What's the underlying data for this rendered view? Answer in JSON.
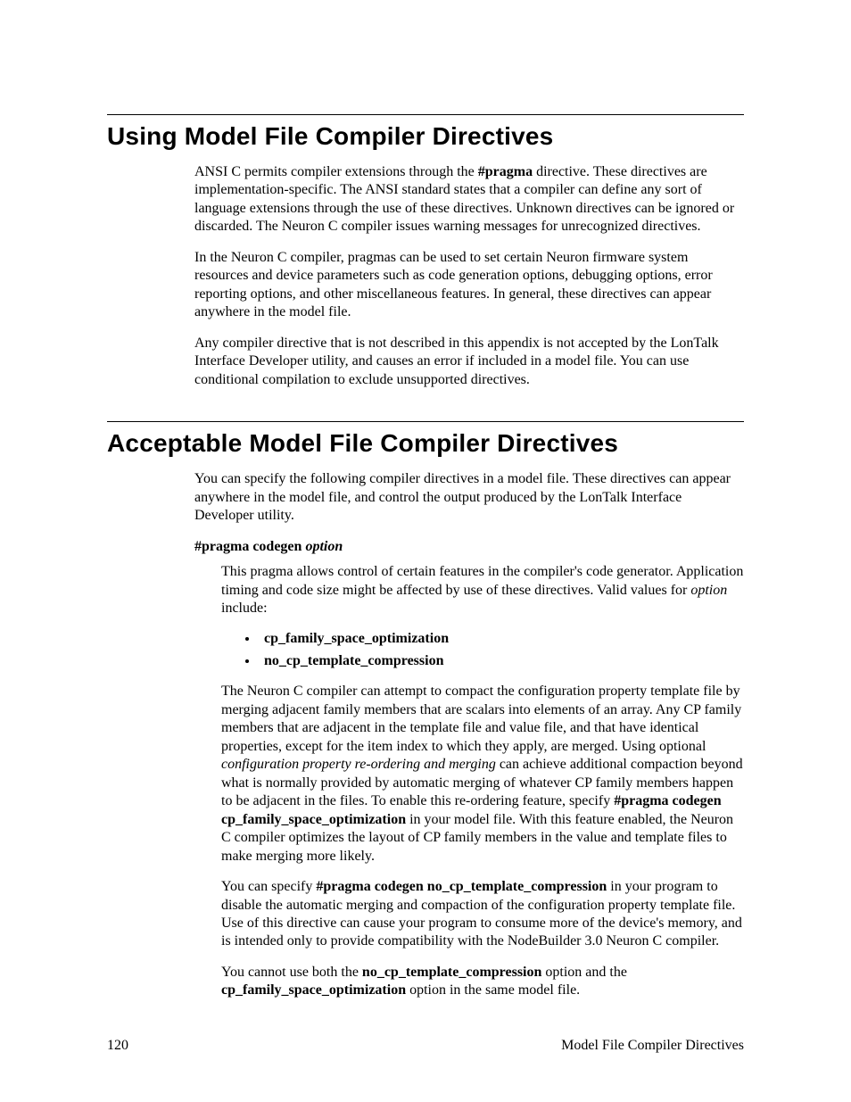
{
  "section1": {
    "heading": "Using Model File Compiler Directives",
    "p1_a": "ANSI C permits compiler extensions through the ",
    "p1_b": "#pragma",
    "p1_c": " directive.  These directives are implementation-specific.  The ANSI standard states that a compiler can define any sort of language extensions through the use of these directives.  Unknown directives can be ignored or discarded.  The Neuron C compiler issues warning messages for unrecognized directives.",
    "p2": "In the Neuron C compiler, pragmas can be used to set certain Neuron firmware system resources and device parameters such as code generation options, debugging options, error reporting options, and other miscellaneous features. In general, these directives can appear anywhere in the model file.",
    "p3": "Any compiler directive that is not described in this appendix is not accepted by the LonTalk Interface Developer utility, and causes an error if included in a model file.  You can use conditional compilation to exclude unsupported directives."
  },
  "section2": {
    "heading": "Acceptable Model File Compiler Directives",
    "p1": "You can specify the following compiler directives in a model file.  These directives can appear anywhere in the model file, and control the output produced by the LonTalk Interface Developer utility.",
    "dir_a": "#pragma codegen",
    "dir_b": " option",
    "p2_a": "This pragma allows control of certain features in the compiler's code generator.  Application timing and code size might be affected by use of these directives.  Valid values for ",
    "p2_b": "option",
    "p2_c": " include:",
    "opt1": "cp_family_space_optimization",
    "opt2": "no_cp_template_compression",
    "p3_a": "The Neuron C compiler can attempt to compact the configuration property template file by merging adjacent family members that are scalars into elements of an array.  Any CP family members that are adjacent in the template file and value file, and that have identical properties, except for the item index to which they apply, are merged.  Using optional ",
    "p3_b": "configuration property re-ordering and merging",
    "p3_c": " can achieve additional compaction beyond what is normally provided by automatic merging of whatever CP family members happen to be adjacent in the files.  To enable this re-ordering feature, specify ",
    "p3_d": "#pragma codegen cp_family_space_optimization",
    "p3_e": " in your model file.  With this feature enabled, the Neuron C compiler optimizes the layout of CP family members in the value and template files to make merging more likely.",
    "p4_a": "You can specify ",
    "p4_b": "#pragma codegen no_cp_template_compression",
    "p4_c": " in your program to disable the automatic merging and compaction of the configuration property template file.  Use of this directive can cause your program to consume more of the device's memory, and is intended only to provide compatibility with the NodeBuilder 3.0 Neuron C compiler.",
    "p5_a": "You cannot use both the ",
    "p5_b": "no_cp_template_compression",
    "p5_c": " option and the ",
    "p5_d": "cp_family_space_optimization",
    "p5_e": " option in the same model file."
  },
  "footer": {
    "page": "120",
    "label": "Model File Compiler Directives"
  }
}
